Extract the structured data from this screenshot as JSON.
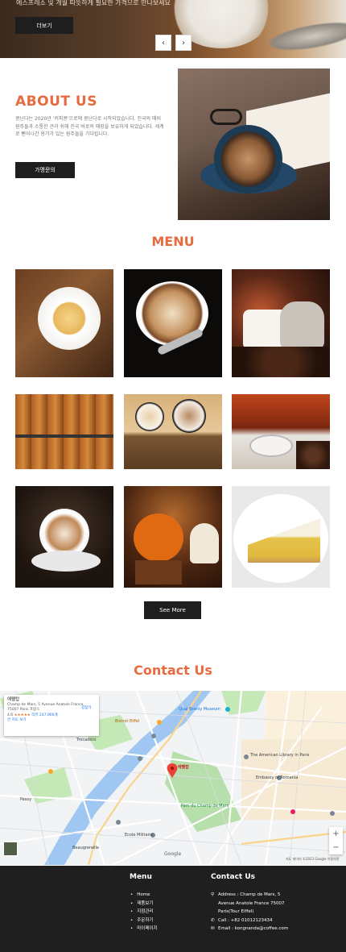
{
  "hero": {
    "caption": "에스프레소 및 개월 따뜻하게 필요한 가격으로 만나보세요",
    "button_label": "더보기",
    "prev_arrow": "‹",
    "next_arrow": "›"
  },
  "about": {
    "title": "ABOUT US",
    "description": "콩난다는 2020년 '커피콩'으로에 콩난다로 시작되었습니다. 진국의 매비 원주들과 소통한 견과 쉬해 진국 바로의 매장을 보유하게 되었습니다. 세계로 뻗어나간 용기가 있는 원주들을 기다립니다.",
    "button_label": "가맹문의"
  },
  "menu": {
    "title": "MENU",
    "items": [
      {
        "name": "coffee-beans-cup"
      },
      {
        "name": "latte-art-cup"
      },
      {
        "name": "coffee-sack"
      },
      {
        "name": "croissants"
      },
      {
        "name": "coffee-and-pastry"
      },
      {
        "name": "fireplace-coffee"
      },
      {
        "name": "latte-dark"
      },
      {
        "name": "halloween-cupcakes"
      },
      {
        "name": "lemon-tart"
      }
    ],
    "see_more_label": "See More"
  },
  "contact": {
    "title": "Contact Us",
    "map": {
      "card_name": "에펠탑",
      "card_address": "Champ de Mars, 5 Avenue Anatole France, 75007 Paris 프랑스",
      "card_rating": "4.6",
      "card_stars": "★★★★★",
      "card_reviews": "리뷰 247,900개",
      "card_directions": "길찾기",
      "card_larger_map": "큰 지도 보기",
      "zoom_in": "+",
      "zoom_out": "−",
      "google": "Google",
      "attribution": "지도 데이터 ©2023 Google   이용약관",
      "labels": {
        "museum": "Quai Branly Museum",
        "bistro": "Bistrot Eiffel",
        "tower": "에펠탑",
        "stadium": "Ecole Militaire",
        "library": "The American Library in Paris",
        "embassy": "Embassy of Romania",
        "rn": "Parc du Champ de Mars",
        "trocadero": "Trocadéro",
        "passy": "Passy",
        "beaugrenelle": "Beaugrenelle"
      }
    }
  },
  "footer": {
    "menu_title": "Menu",
    "menu_items": [
      "Home",
      "제품보기",
      "지점관리",
      "주문하기",
      "마이페이지"
    ],
    "contact_title": "Contact Us",
    "address": "Address : Champ de Mars, 5 Avenue Anatole France 75007 Paris(Tour Eiffel)",
    "call": "Call : +82 01012123434",
    "email": "Email : kongnanda@coffee.com"
  },
  "colors": {
    "accent": "#e86b3f",
    "dark": "#1f1f1f"
  }
}
